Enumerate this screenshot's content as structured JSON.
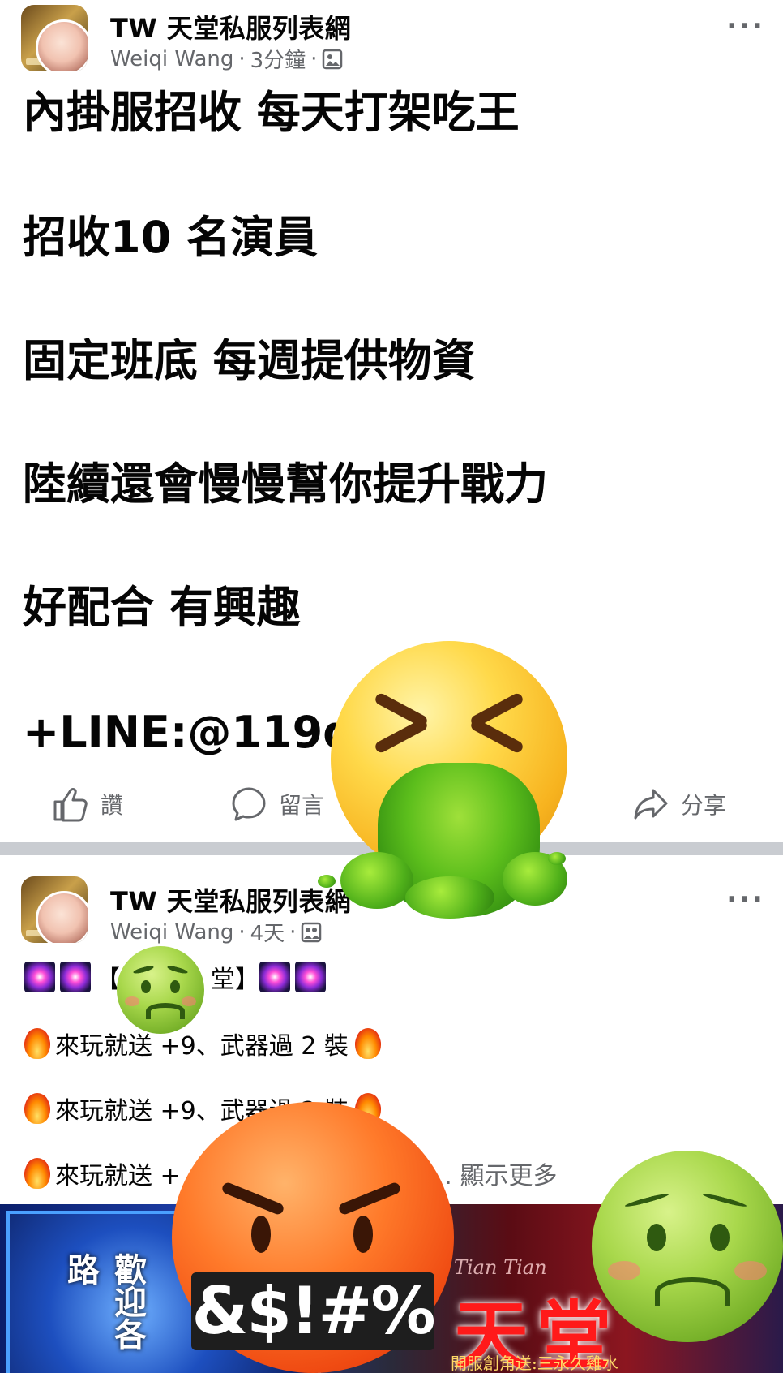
{
  "post1": {
    "page_name": "TW 天堂私服列表網",
    "author": "Weiqi Wang",
    "time": "3分鐘",
    "lines": [
      "內掛服招收 每天打架吃王",
      "招收10 名演員",
      "固定班底  每週提供物資",
      "陸續還會慢慢幫你提升戰力",
      "好配合 有興趣",
      "+LINE:@119d"
    ]
  },
  "actions": {
    "like": "讚",
    "comment": "留言",
    "share": "分享"
  },
  "post2": {
    "page_name": "TW 天堂私服列表網",
    "author": "Weiqi Wang",
    "time": "4天",
    "title_left": "【",
    "title_right": "堂】",
    "line1": "來玩就送 +9、武器過 2 裝",
    "line2": "來玩就送 +9、武器過 2 裝",
    "line3": "來玩就送 +",
    "see_more": "… 顯示更多",
    "banner": {
      "welcome": "歡迎各路",
      "deco": "Tian Tian",
      "big": "天堂",
      "promo": "開服創角送:三永久雞水"
    }
  },
  "overlay": {
    "censor_text": "&$!#%"
  },
  "icons": [
    "more-icon",
    "public-icon",
    "like-icon",
    "comment-icon",
    "share-icon",
    "firework-icon",
    "fire-icon"
  ],
  "colors": {
    "text": "#050505",
    "muted": "#65676b",
    "divider": "#c9ccd1"
  }
}
